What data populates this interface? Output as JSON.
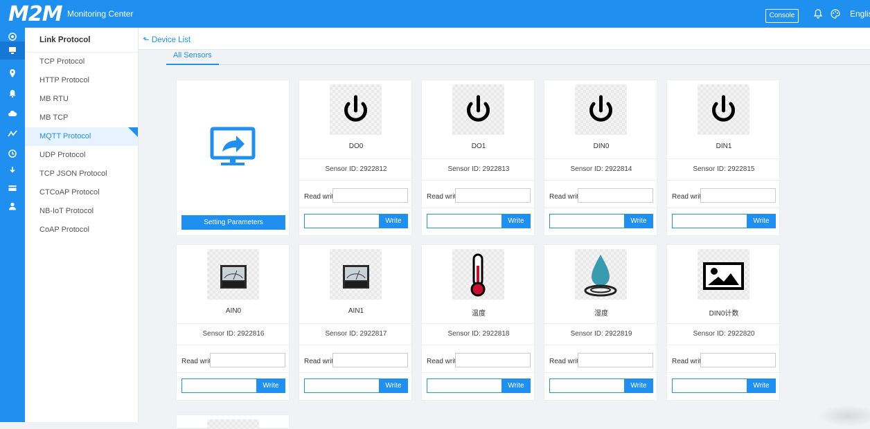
{
  "header": {
    "logo": "M2M",
    "title": "Monitoring Center",
    "console_label": "Console",
    "language": "English"
  },
  "rail_icons": [
    "target-icon",
    "device-icon",
    "location-icon",
    "alarm-icon",
    "cloud-icon",
    "chart-icon",
    "clock-icon",
    "download-icon",
    "card-icon",
    "user-icon"
  ],
  "sidebar": {
    "heading": "Link Protocol",
    "items": [
      {
        "label": "TCP Protocol"
      },
      {
        "label": "HTTP Protocol"
      },
      {
        "label": "MB RTU"
      },
      {
        "label": "MB TCP"
      },
      {
        "label": "MQTT Protocol",
        "active": true
      },
      {
        "label": "UDP Protocol"
      },
      {
        "label": "TCP JSON Protocol"
      },
      {
        "label": "CTCoAP Protocol"
      },
      {
        "label": "NB-IoT Protocol"
      },
      {
        "label": "CoAP Protocol"
      }
    ]
  },
  "breadcrumb": "Device List",
  "tab": "All Sensors",
  "setting_button": "Setting Parameters",
  "read_write_label": "Read write",
  "write_label": "Write",
  "sensors": [
    {
      "name": "DO0",
      "id": "Sensor ID: 2922812",
      "icon": "power-icon"
    },
    {
      "name": "DO1",
      "id": "Sensor ID: 2922813",
      "icon": "power-icon"
    },
    {
      "name": "DIN0",
      "id": "Sensor ID: 2922814",
      "icon": "power-icon"
    },
    {
      "name": "DIN1",
      "id": "Sensor ID: 2922815",
      "icon": "power-icon"
    },
    {
      "name": "AIN0",
      "id": "Sensor ID: 2922816",
      "icon": "ammeter-icon"
    },
    {
      "name": "AIN1",
      "id": "Sensor ID: 2922817",
      "icon": "ammeter-icon"
    },
    {
      "name": "温度",
      "id": "Sensor ID: 2922818",
      "icon": "thermometer-icon"
    },
    {
      "name": "湿度",
      "id": "Sensor ID: 2922819",
      "icon": "water-drop-icon"
    },
    {
      "name": "DIN0计数",
      "id": "Sensor ID: 2922820",
      "icon": "image-icon"
    }
  ],
  "colors": {
    "primary": "#1f8ff0",
    "background": "#f0f2f5"
  }
}
